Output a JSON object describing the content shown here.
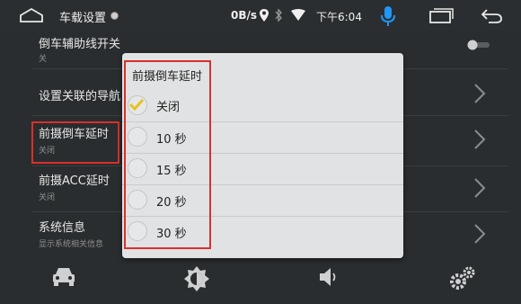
{
  "statusbar": {
    "title": "车载设置",
    "speed": "0B/s",
    "time": "下午6:04",
    "mic_color": "#2196f3"
  },
  "settings": {
    "items": [
      {
        "title": "倒车辅助线开关",
        "subtitle": "关"
      },
      {
        "title": "设置关联的导航",
        "subtitle": ""
      },
      {
        "title": "前摄倒车延时",
        "subtitle": "关闭"
      },
      {
        "title": "前摄ACC延时",
        "subtitle": "关闭"
      },
      {
        "title": "系统信息",
        "subtitle": "显示系统相关信息"
      }
    ]
  },
  "dialog": {
    "title": "前摄倒车延时",
    "options": [
      {
        "label": "关闭",
        "selected": true
      },
      {
        "label": "10 秒",
        "selected": false
      },
      {
        "label": "15 秒",
        "selected": false
      },
      {
        "label": "20 秒",
        "selected": false
      },
      {
        "label": "30 秒",
        "selected": false
      }
    ]
  },
  "bottom_nav": [
    "car-icon",
    "brightness-icon",
    "volume-icon",
    "settings-gears-icon"
  ],
  "colors": {
    "highlight_box": "#d8302c",
    "check": "#e8c21a"
  }
}
